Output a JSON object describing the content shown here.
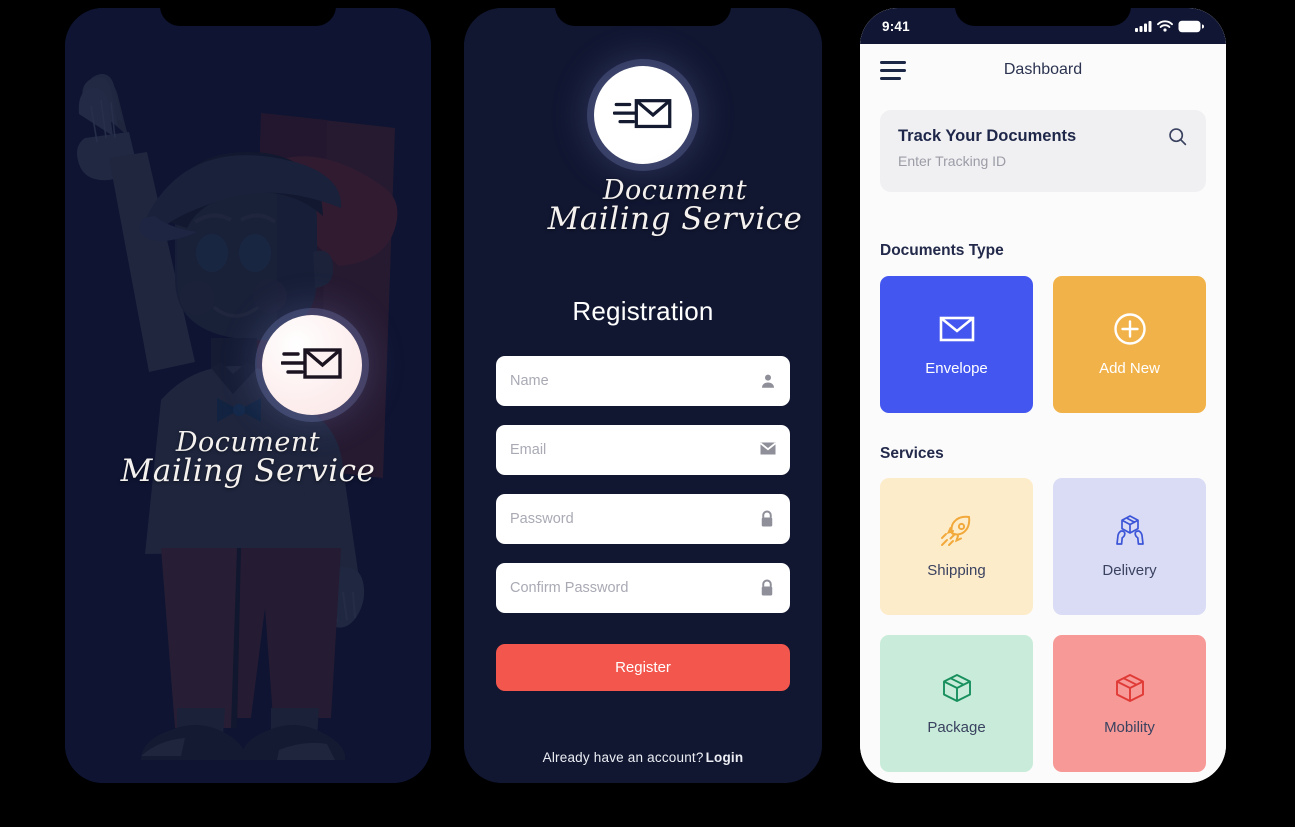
{
  "brand": {
    "line1": "Document",
    "line2": "Mailing Service",
    "logo_icon": "envelope-speed-icon"
  },
  "splash": {
    "illustration": "mail-carrier-waving-illustration"
  },
  "registration": {
    "title": "Registration",
    "fields": [
      {
        "placeholder": "Name",
        "icon": "person-icon",
        "type": "text"
      },
      {
        "placeholder": "Email",
        "icon": "envelope-icon",
        "type": "email"
      },
      {
        "placeholder": "Password",
        "icon": "lock-icon",
        "type": "password"
      },
      {
        "placeholder": "Confirm Password",
        "icon": "lock-icon",
        "type": "password"
      }
    ],
    "submit_label": "Register",
    "footer_text": "Already have an account?",
    "footer_link": "Login",
    "button_color": "#f2564d"
  },
  "dashboard": {
    "status_bar": {
      "time": "9:41",
      "icons": [
        "signal-icon",
        "wifi-icon",
        "battery-icon"
      ]
    },
    "appbar": {
      "title": "Dashboard",
      "menu_icon": "hamburger-menu-icon"
    },
    "track": {
      "title": "Track Your Documents",
      "placeholder": "Enter Tracking ID",
      "search_icon": "search-icon"
    },
    "documents_section": {
      "title": "Documents Type",
      "cards": [
        {
          "label": "Envelope",
          "icon": "envelope-icon",
          "bg": "#4356f0",
          "fg": "#ffffff"
        },
        {
          "label": "Add New",
          "icon": "plus-circle-icon",
          "bg": "#f1b24a",
          "fg": "#ffffff"
        }
      ]
    },
    "services_section": {
      "title": "Services",
      "cards": [
        {
          "label": "Shipping",
          "icon": "rocket-icon",
          "bg": "#fdecca",
          "fg": "#f2a93b",
          "label_color": "#3a4260"
        },
        {
          "label": "Delivery",
          "icon": "hands-box-icon",
          "bg": "#d9dcf4",
          "fg": "#3c55d8",
          "label_color": "#3a4260"
        },
        {
          "label": "Package",
          "icon": "box-icon",
          "bg": "#c8ecd9",
          "fg": "#18905e",
          "label_color": "#3a4260"
        },
        {
          "label": "Mobility",
          "icon": "box-icon",
          "bg": "#f79a97",
          "fg": "#e03a36",
          "label_color": "#3a4260"
        }
      ]
    }
  }
}
